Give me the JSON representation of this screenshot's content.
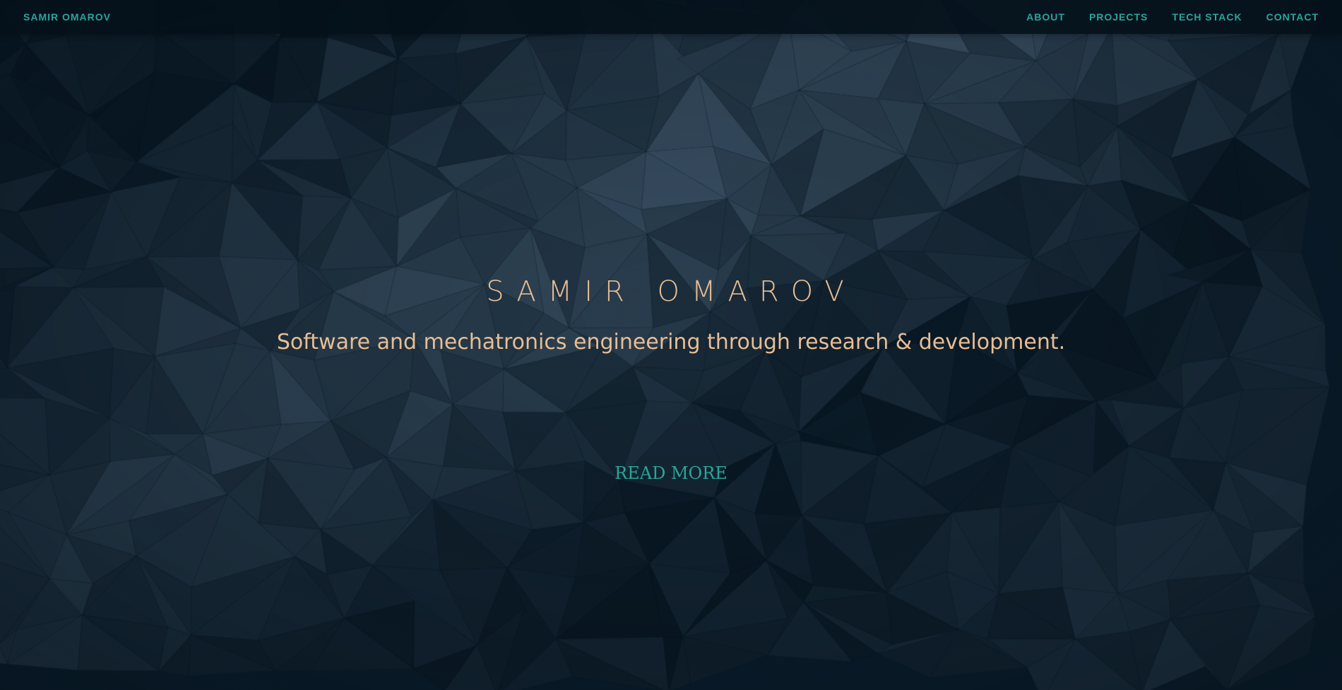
{
  "navbar": {
    "brand": "SAMIR OMAROV",
    "links": [
      {
        "label": "ABOUT"
      },
      {
        "label": "PROJECTS"
      },
      {
        "label": "TECH STACK"
      },
      {
        "label": "CONTACT"
      }
    ]
  },
  "hero": {
    "title": "SAMIR OMAROV",
    "subtitle": "Software and mechatronics engineering through research & development.",
    "cta": "READ MORE"
  },
  "colors": {
    "background": "#0a1d2b",
    "accent": "#2aa59a",
    "title": "#e7bd94"
  }
}
